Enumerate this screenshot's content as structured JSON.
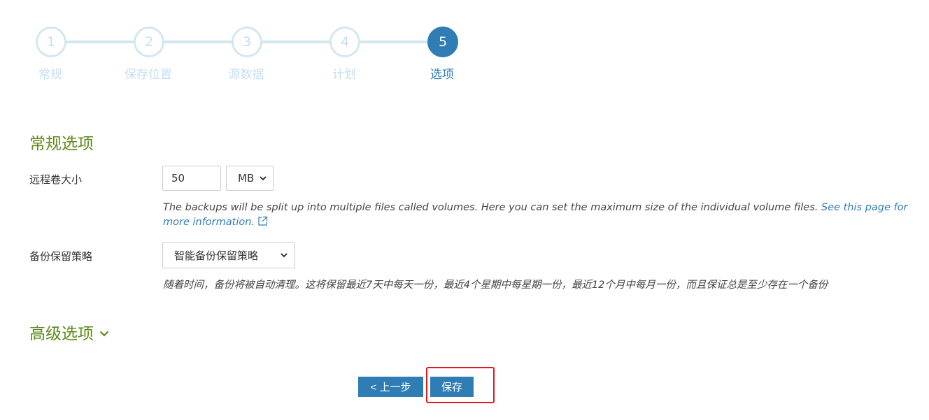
{
  "stepper": {
    "steps": [
      {
        "number": "1",
        "label": "常规"
      },
      {
        "number": "2",
        "label": "保存位置"
      },
      {
        "number": "3",
        "label": "源数据"
      },
      {
        "number": "4",
        "label": "计划"
      },
      {
        "number": "5",
        "label": "选项"
      }
    ],
    "active_step": 5
  },
  "general": {
    "title": "常规选项",
    "remote_volume": {
      "label": "远程卷大小",
      "value": "50",
      "unit": "MB",
      "help_text": "The backups will be split up into multiple files called volumes. Here you can set the maximum size of the individual volume files.",
      "link_text": "See this page for more information.",
      "link_icon": "external-link-icon"
    },
    "retention": {
      "label": "备份保留策略",
      "value": "智能备份保留策略",
      "help_text": "随着时间，备份将被自动清理。这将保留最近7天中每天一份，最近4个星期中每星期一份，最近12个月中每月一份，而且保证总是至少存在一个备份"
    }
  },
  "advanced": {
    "title": "高级选项",
    "icon": "chevron-down-icon"
  },
  "actions": {
    "back_label": "< 上一步",
    "save_label": "保存"
  },
  "colors": {
    "accent": "#2f7db4",
    "section_title": "#5c8b1b",
    "step_inactive": "#d3e7f3",
    "highlight": "#e0191f"
  }
}
